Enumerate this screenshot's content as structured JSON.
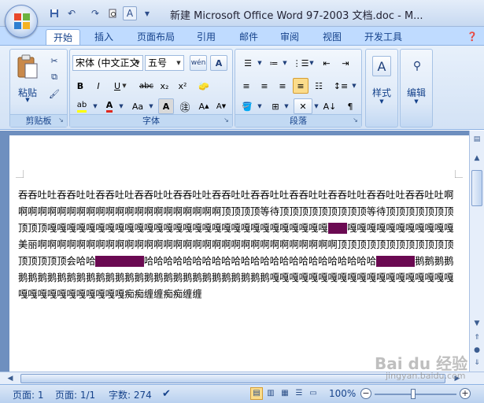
{
  "window": {
    "title": "新建 Microsoft Office Word 97-2003 文档.doc - M...",
    "quick_access": [
      "save-icon",
      "undo-icon",
      "redo-icon",
      "print-preview-icon",
      "text-highlight-icon",
      "customize-dropdown-icon"
    ]
  },
  "tabs": [
    "开始",
    "插入",
    "页面布局",
    "引用",
    "邮件",
    "审阅",
    "视图",
    "开发工具"
  ],
  "active_tab": "开始",
  "ribbon": {
    "clipboard": {
      "label": "剪贴板",
      "paste": "粘贴"
    },
    "font": {
      "label": "字体",
      "font_name": "宋体 (中文正文",
      "font_size": "五号",
      "wen_icon": "wén",
      "aa_box": "A"
    },
    "paragraph": {
      "label": "段落"
    },
    "styles": {
      "label": "样式"
    },
    "editing": {
      "label": "编辑"
    }
  },
  "document": {
    "segments": [
      {
        "text": "吞吞吐吐吞吞吐吐吞吞吐吐吞吞吐吐吞吞吐吐吞吞吐吐吞吞吐吐吞吞吐吐吞吞吐吐吞吞吐吐吞吞吐吐啊啊啊啊啊啊啊啊啊啊啊啊啊啊啊啊啊啊啊啊啊啊顶顶顶顶等待顶顶顶顶顶顶顶顶顶等待顶顶顶顶顶顶顶顶顶顶嘎嘎嘎嘎嘎嘎嘎嘎嘎嘎嘎嘎嘎嘎嘎嘎嘎嘎嘎嘎嘎嘎嘎嘎嘎嘎嘎嘎嘎",
        "hl": false
      },
      {
        "text": "美丽",
        "hl": true
      },
      {
        "text": "嘎嘎嘎嘎嘎嘎嘎嘎嘎嘎嘎美丽啊啊啊啊啊啊啊啊啊啊啊啊啊啊啊啊啊啊啊啊啊啊啊啊啊啊啊啊啊啊啊顶顶顶顶顶顶顶顶顶顶顶顶顶顶顶顶顶会哈哈",
        "hl": false
      },
      {
        "text": "哈哈哈哈哈",
        "hl": true
      },
      {
        "text": "哈哈哈哈哈哈哈哈哈哈哈哈哈哈哈哈哈哈哈哈哈哈哈哈",
        "hl": false
      },
      {
        "text": "鹅鹅鹅鹅",
        "hl": true
      },
      {
        "text": "鹅鹅鹅鹅鹅鹅鹅鹅鹅鹅鹅鹅鹅鹅鹅鹅鹅鹅鹅鹅鹅鹅鹅鹅鹅鹅鹅鹅鹅鹅嘎嘎嘎嘎嘎嘎嘎嘎嘎嘎嘎嘎嘎嘎嘎嘎嘎嘎嘎嘎嘎嘎嘎嘎嘎嘎嘎嘎嘎嘎痴痴缠缠痴痴缠缠",
        "hl": false
      }
    ],
    "highlight_color": "#6b0a52"
  },
  "status_bar": {
    "page": "页面: 1",
    "pages": "页面: 1/1",
    "word_count": "字数: 274",
    "zoom": "100%",
    "zoom_level_percent": 100
  },
  "watermark": {
    "main": "Bai du 经验",
    "sub": "jingyan.baidu.com"
  }
}
